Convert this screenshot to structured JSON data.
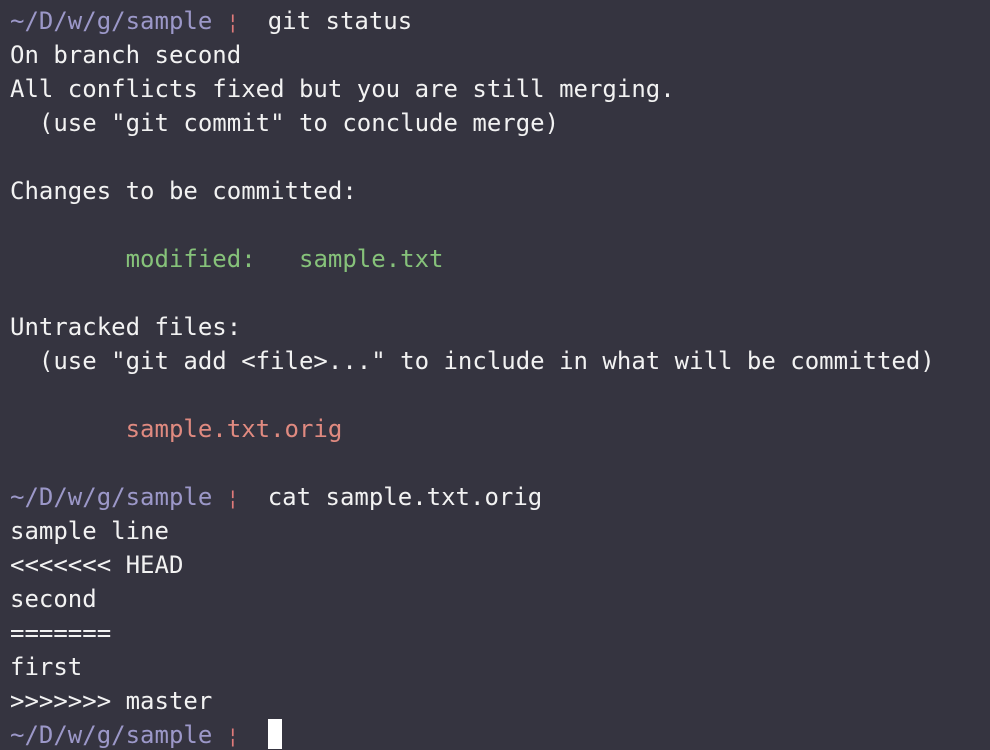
{
  "prompt": {
    "path": "~/D/w/g/sample",
    "separator": "¦"
  },
  "colors": {
    "background": "#353440",
    "text": "#f2f2f2",
    "path": "#9c98c9",
    "staged": "#86c27a",
    "untracked": "#e08a80"
  },
  "commands": {
    "first": "git status",
    "second": "cat sample.txt.orig"
  },
  "status": {
    "branch": "On branch second",
    "merge_state": "All conflicts fixed but you are still merging.",
    "merge_hint": "  (use \"git commit\" to conclude merge)",
    "staged_header": "Changes to be committed:",
    "modified_label": "modified:",
    "modified_file": "sample.txt",
    "untracked_header": "Untracked files:",
    "untracked_hint": "  (use \"git add <file>...\" to include in what will be committed)",
    "untracked_file": "sample.txt.orig"
  },
  "cat_output": [
    "sample line",
    "<<<<<<< HEAD",
    "second",
    "=======",
    "first",
    ">>>>>>> master"
  ]
}
